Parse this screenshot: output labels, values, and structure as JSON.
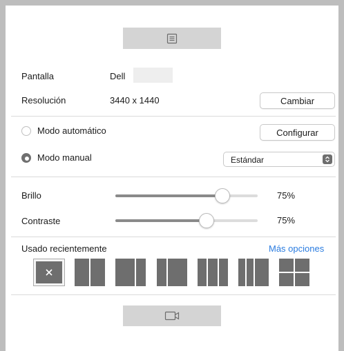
{
  "display": {
    "label": "Pantalla",
    "value": "Dell"
  },
  "resolution": {
    "label": "Resolución",
    "value": "3440 x 1440",
    "change_button": "Cambiar"
  },
  "modes": {
    "auto": {
      "label": "Modo automático",
      "selected": false,
      "configure_button": "Configurar"
    },
    "manual": {
      "label": "Modo manual",
      "selected": true,
      "preset": "Estándar"
    }
  },
  "brightness": {
    "label": "Brillo",
    "value_text": "75%",
    "value": 0.75
  },
  "contrast": {
    "label": "Contraste",
    "value_text": "75%",
    "value": 0.75
  },
  "recent": {
    "label": "Usado recientemente",
    "more_link": "Más opciones"
  },
  "icons": {
    "top": "document-lines-icon",
    "bottom": "video-camera-icon",
    "clear": "close-icon"
  },
  "colors": {
    "accent_link": "#2a7ce0",
    "layout_tile": "#6e6e6e",
    "header_button": "#d4d4d4"
  }
}
